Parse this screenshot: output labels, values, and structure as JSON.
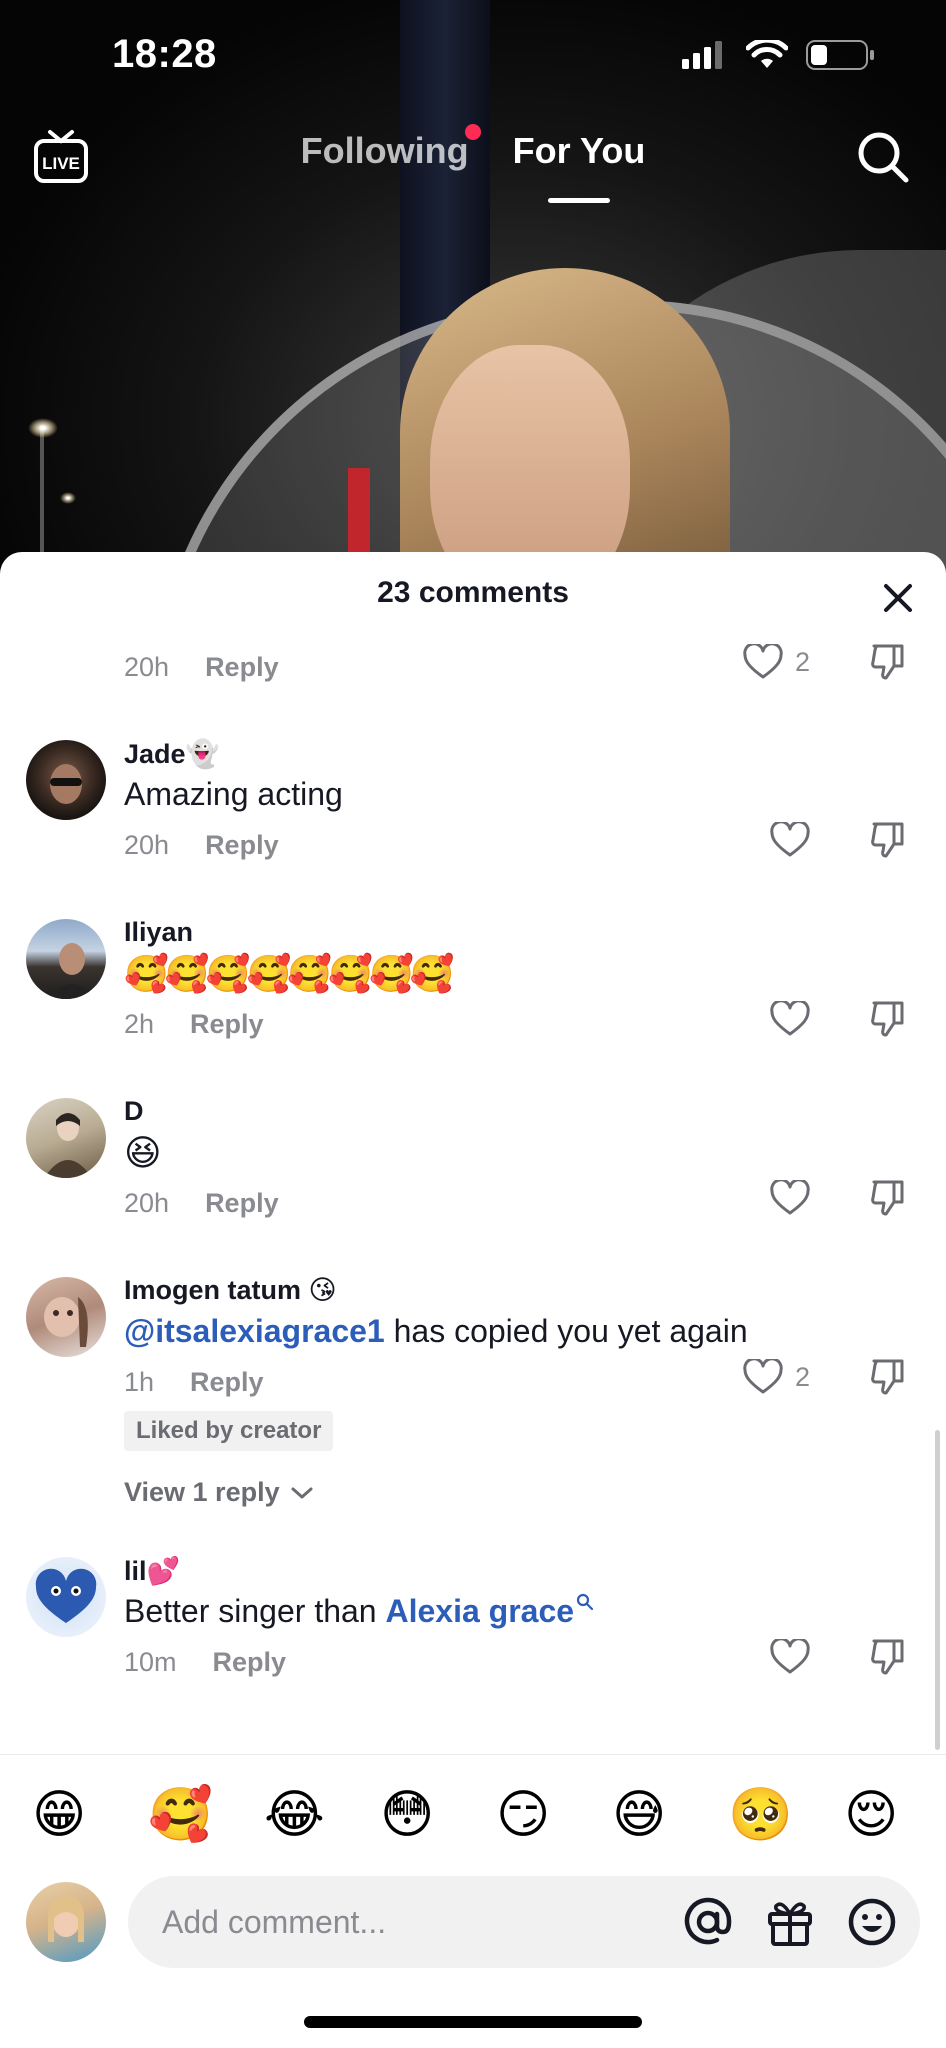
{
  "status_bar": {
    "time": "18:28"
  },
  "top_nav": {
    "live_label": "LIVE",
    "tabs": [
      {
        "label": "Following",
        "has_notification_dot": true
      },
      {
        "label": "For You",
        "active": true
      }
    ]
  },
  "comments_sheet": {
    "title": "23 comments",
    "partial_comment": {
      "time": "20h",
      "reply_label": "Reply",
      "likes": "2"
    },
    "comments": [
      {
        "username": "Jade👻",
        "text": "Amazing acting",
        "time": "20h",
        "reply_label": "Reply",
        "likes": ""
      },
      {
        "username": "Iliyan",
        "text": "🥰🥰🥰🥰🥰🥰🥰🥰",
        "time": "2h",
        "reply_label": "Reply",
        "likes": ""
      },
      {
        "username": "D",
        "text": "😆",
        "time": "20h",
        "reply_label": "Reply",
        "likes": ""
      },
      {
        "username": "Imogen tatum 😘",
        "mention": "@itsalexiagrace1",
        "text": " has copied you yet again",
        "time": "1h",
        "reply_label": "Reply",
        "likes": "2",
        "badge": "Liked by creator",
        "view_replies": "View 1 reply"
      },
      {
        "username": "lil💕",
        "text": "Better singer than ",
        "link": "Alexia grace",
        "time": "10m",
        "reply_label": "Reply",
        "likes": ""
      }
    ]
  },
  "emoji_bar": [
    "😁",
    "🥰",
    "😂",
    "😳",
    "😏",
    "😅",
    "🥺",
    "😌"
  ],
  "comment_input": {
    "placeholder": "Add comment..."
  },
  "colors": {
    "accent_red": "#fe2c55",
    "mention_blue": "#2b5db9",
    "text_primary": "#161823",
    "text_secondary": "#8a8b91"
  }
}
